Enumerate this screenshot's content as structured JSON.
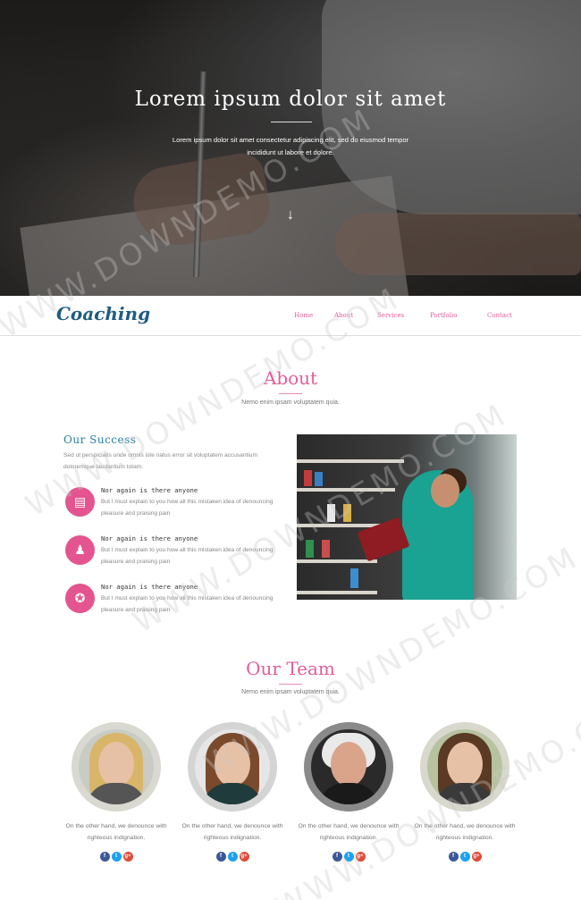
{
  "hero": {
    "title": "Lorem ipsum dolor sit amet",
    "subtitle": "Lorem ipsum dolor sit amet consectetur adipiscing elit, sed do eiusmod tempor incididunt ut labore et dolore.",
    "scroll_icon": "arrow-down-icon"
  },
  "nav": {
    "logo": "Coaching",
    "items": [
      "Home",
      "About",
      "Services",
      "Portfolio",
      "Contact"
    ]
  },
  "about": {
    "title": "About",
    "subtitle": "Nemo enim ipsam voluptatem quia.",
    "success_title": "Our Success",
    "success_text": "Sed ut perspiciatis unde omnis iste natus error sit voluptatem accusantium doloremque laudantium totam.",
    "features": [
      {
        "icon": "presentation-board-icon",
        "title": "Nor again is there anyone",
        "text": "But I must explain to you how all this mistaken idea of denouncing pleasure and praising pain"
      },
      {
        "icon": "graduate-user-icon",
        "title": "Nor again is there anyone",
        "text": "But I must explain to you how all this mistaken idea of denouncing pleasure and praising pain"
      },
      {
        "icon": "award-ribbon-icon",
        "title": "Nor again is there anyone",
        "text": "But I must explain to you how all this mistaken idea of denouncing pleasure and praising pain"
      }
    ]
  },
  "team": {
    "title": "Our Team",
    "subtitle": "Nemo enim ipsam voluptatem quia.",
    "members": [
      {
        "text": "On the other hand, we denounce with righteous indignation."
      },
      {
        "text": "On the other hand, we denounce with righteous indignation."
      },
      {
        "text": "On the other hand, we denounce with righteous indignation."
      },
      {
        "text": "On the other hand, we denounce with righteous indignation."
      }
    ],
    "socials": [
      {
        "icon": "facebook-icon",
        "glyph": "f",
        "color": "#3b5998"
      },
      {
        "icon": "twitter-icon",
        "glyph": "t",
        "color": "#1da1f2"
      },
      {
        "icon": "google-plus-icon",
        "glyph": "g+",
        "color": "#dd4b39"
      }
    ]
  },
  "colors": {
    "accent": "#e45c9a",
    "heading_blue": "#2a7fa8",
    "logo": "#1f5c84"
  },
  "watermark": "WWW.DOWNDEMO.COM"
}
